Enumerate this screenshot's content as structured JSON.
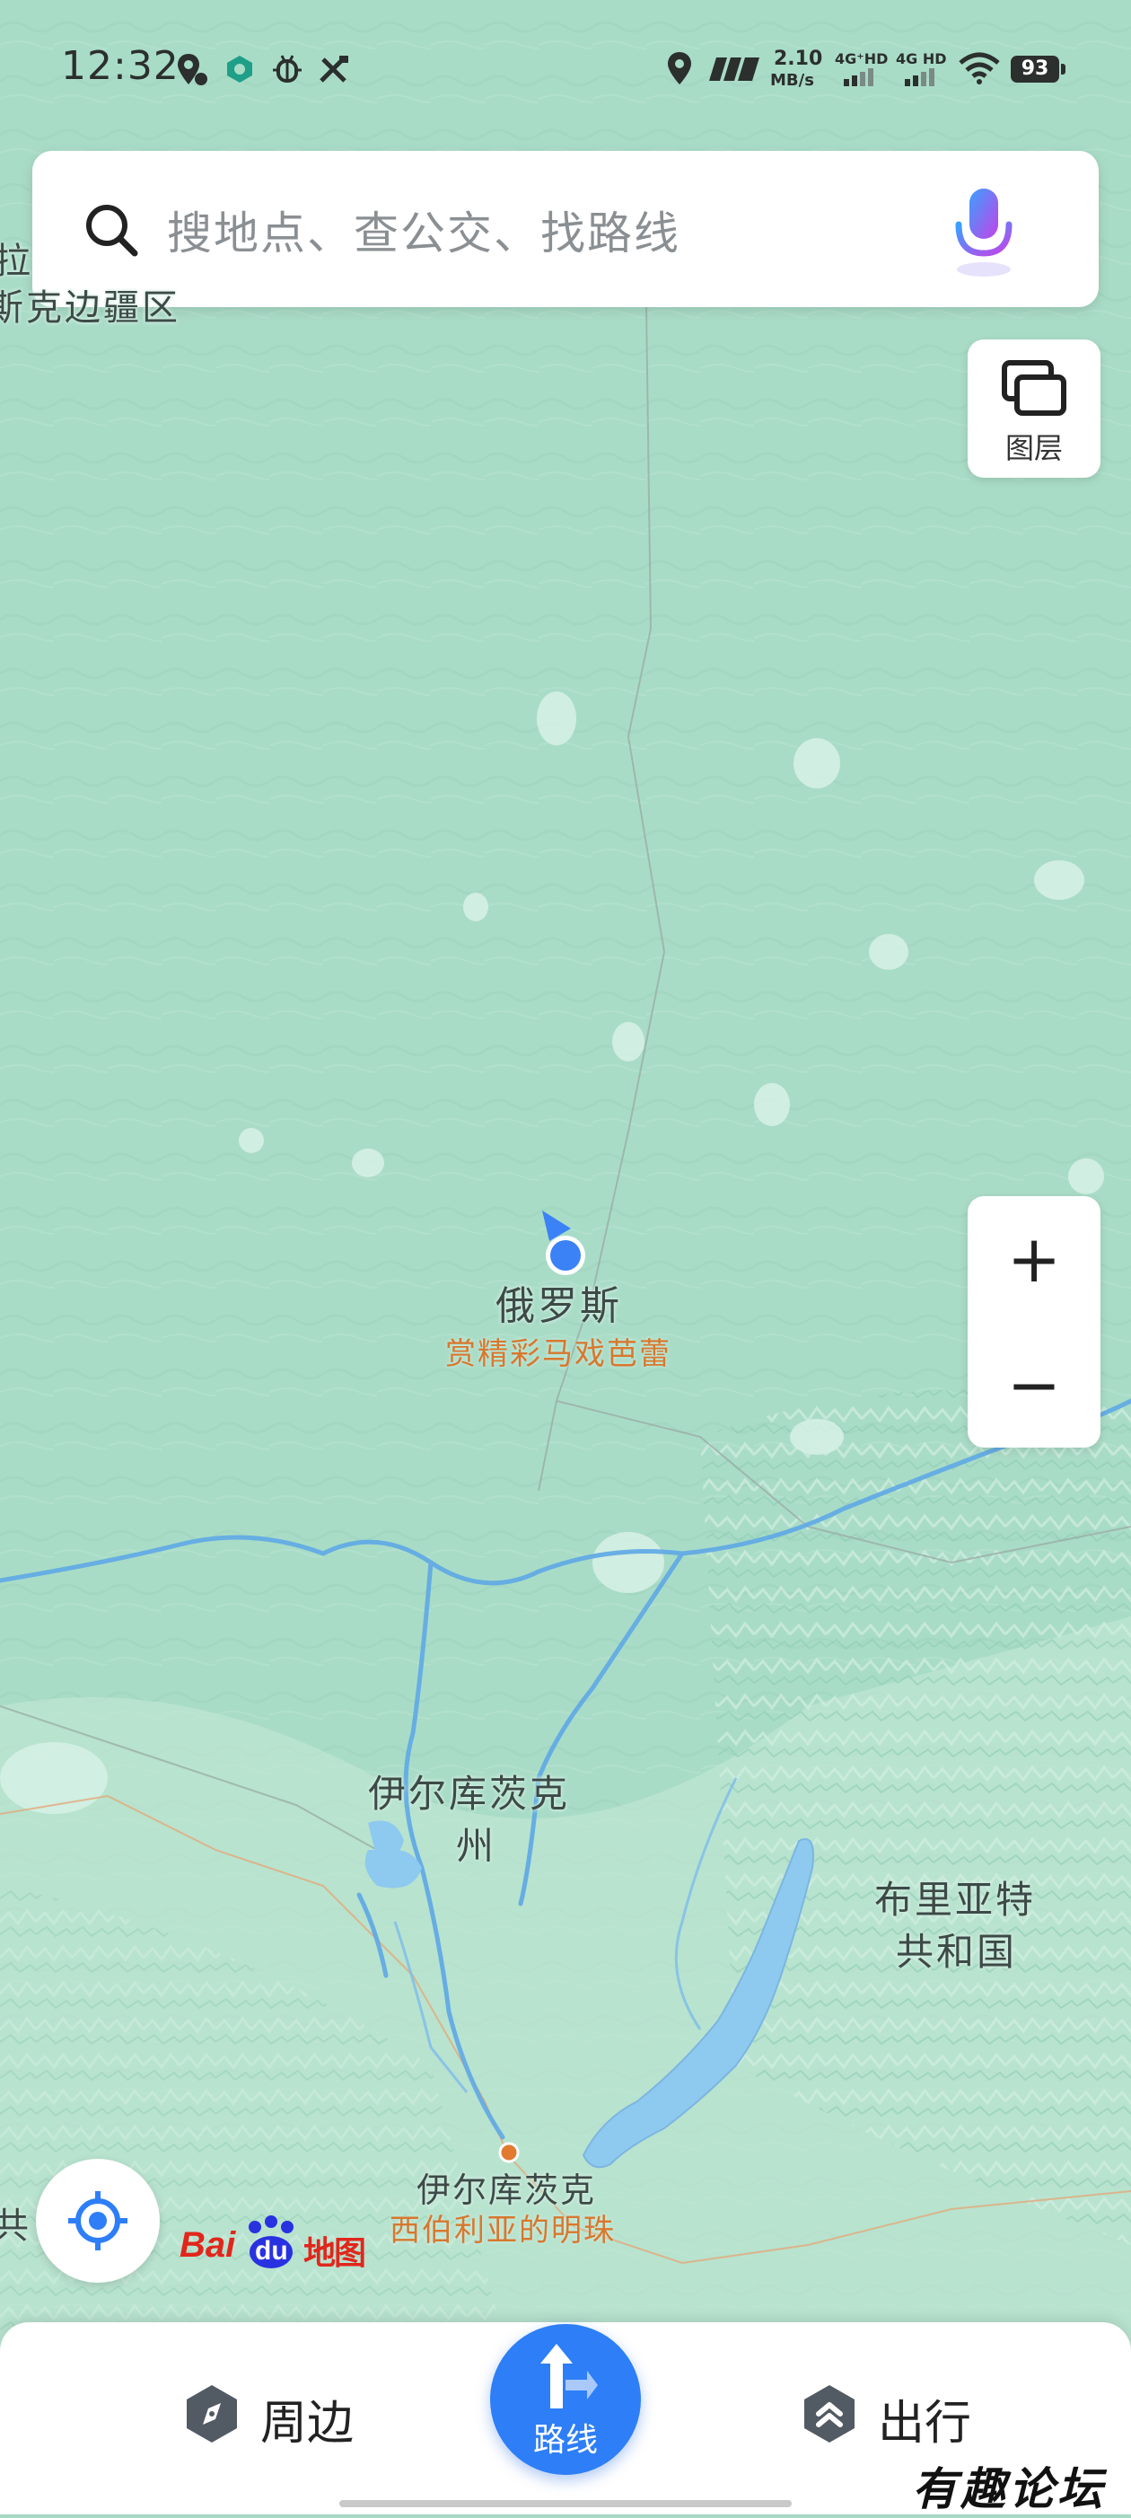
{
  "status_bar": {
    "time": "12:32",
    "network_speed_value": "2.10",
    "network_speed_unit": "MB/s",
    "signal1": "4G⁺HD",
    "signal2": "4G HD",
    "battery": "93"
  },
  "search": {
    "placeholder": "搜地点、查公交、找路线"
  },
  "layers": {
    "label": "图层"
  },
  "zoom": {
    "in_label": "+",
    "out_label": "−"
  },
  "map": {
    "labels": {
      "russia": "俄罗斯",
      "russia_sub": "赏精彩马戏芭蕾",
      "irkutsk_oblast_line1": "伊尔库茨克",
      "irkutsk_oblast_line2": "州",
      "buryatia_line1": "布里亚特",
      "buryatia_line2": "共和国",
      "irkutsk_city": "伊尔库茨克",
      "irkutsk_city_sub": "西伯利亚的明珠",
      "edge_top_left_1": "拉",
      "edge_top_left_2": "斯克边疆区",
      "edge_left": "共"
    },
    "colors": {
      "land": "#a9dcc7",
      "water": "#8ec9ef",
      "river": "#5ea8e6",
      "location_dot": "#3b82f6",
      "label_orange": "#d7782e"
    }
  },
  "logo": {
    "text_bai": "Bai",
    "text_du": "du",
    "text_ditu": "地图"
  },
  "bottom_bar": {
    "nearby_label": "周边",
    "route_label": "路线",
    "travel_label": "出行"
  },
  "watermark": "有趣论坛"
}
